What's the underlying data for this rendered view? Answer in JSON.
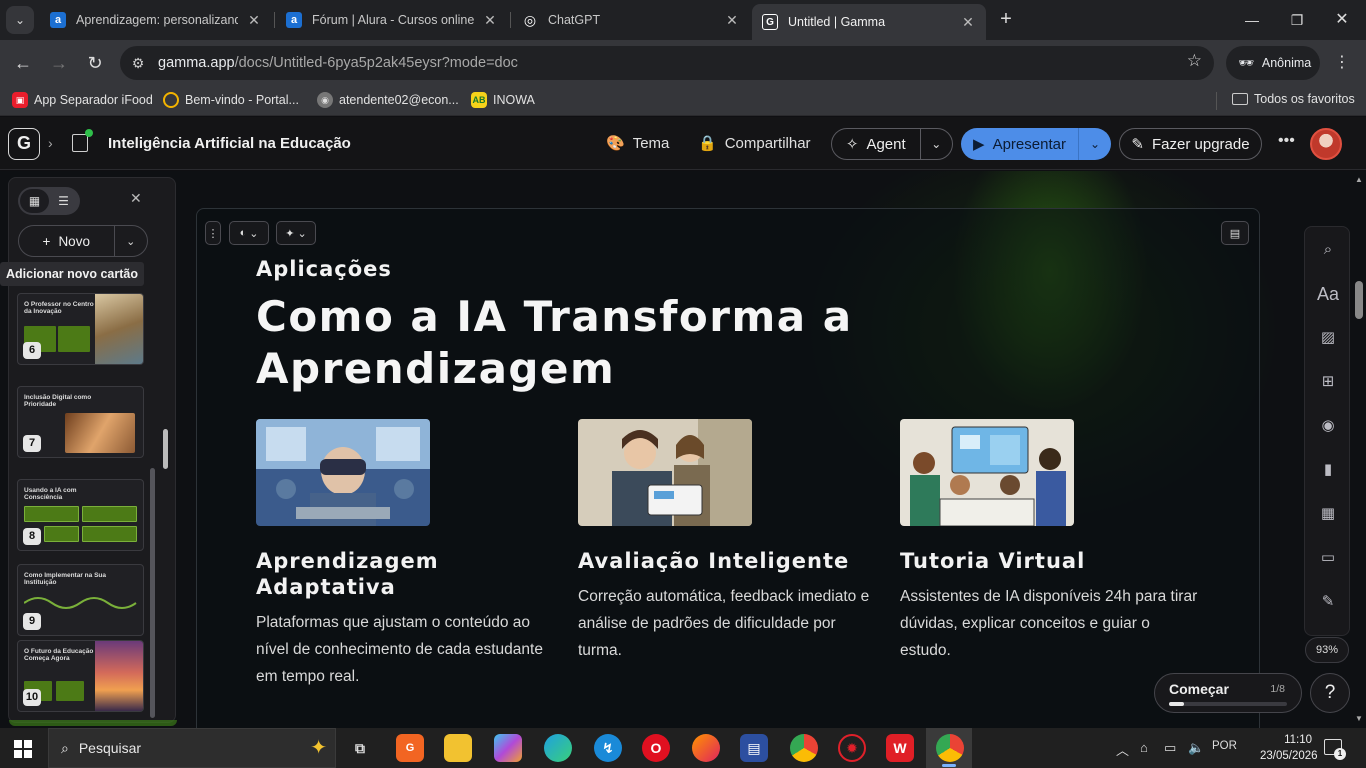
{
  "browser": {
    "tabs": [
      {
        "title": "Aprendizagem: personalizando",
        "favicon": "a",
        "favicon_color": "#1c6fd1",
        "active": false
      },
      {
        "title": "Fórum | Alura - Cursos online d",
        "favicon": "a",
        "favicon_color": "#1c6fd1",
        "active": false
      },
      {
        "title": "ChatGPT",
        "favicon": "◎",
        "favicon_color": "#ffffff",
        "active": false
      },
      {
        "title": "Untitled | Gamma",
        "favicon": "G",
        "favicon_color": "#ffffff",
        "active": true
      }
    ],
    "url_host": "gamma.app",
    "url_path": "/docs/Untitled-6pya5p2ak45eysr?mode=doc",
    "profile_label": "Anônima",
    "bookmarks": [
      {
        "label": "App Separador iFood",
        "icon_color": "#ea1d2c",
        "icon": "▣"
      },
      {
        "label": "Bem-vindo - Portal...",
        "icon_color": "#f2b300",
        "icon": "○"
      },
      {
        "label": "atendente02@econ...",
        "icon_color": "#888888",
        "icon": "◉"
      },
      {
        "label": "INOWA",
        "icon_color": "#f6d21a",
        "icon": "AB"
      }
    ],
    "all_bookmarks_label": "Todos os favoritos"
  },
  "app": {
    "logo": "G",
    "doc_title": "Inteligência Artificial na Educação",
    "theme_label": "Tema",
    "share_label": "Compartilhar",
    "agent_label": "Agent",
    "present_label": "Apresentar",
    "upgrade_label": "Fazer upgrade",
    "accent_color": "#4d8de8"
  },
  "sidebar": {
    "new_label": "Novo",
    "tooltip": "Adicionar novo cartão",
    "thumbnails": [
      {
        "number": "6",
        "title": "O Professor no Centro da Inovação"
      },
      {
        "number": "7",
        "title": "Inclusão Digital como Prioridade"
      },
      {
        "number": "8",
        "title": "Usando a IA com Consciência"
      },
      {
        "number": "9",
        "title": "Como Implementar na Sua Instituição"
      },
      {
        "number": "10",
        "title": "O Futuro da Educação Começa Agora"
      }
    ]
  },
  "card": {
    "kicker": "Aplicações",
    "headline": "Como a IA Transforma a Aprendizagem",
    "features": [
      {
        "title": "Aprendizagem Adaptativa",
        "body": "Plataformas que ajustam o conteúdo ao nível de conhecimento de cada estudante em tempo real."
      },
      {
        "title": "Avaliação Inteligente",
        "body": "Correção automática, feedback imediato e análise de padrões de dificuldade por turma."
      },
      {
        "title": "Tutoria Virtual",
        "body": "Assistentes de IA disponíveis 24h para tirar dúvidas, explicar conceitos e guiar o estudo."
      }
    ]
  },
  "rail": {
    "zoom": "93%",
    "start_label": "Começar",
    "start_progress": "1/8",
    "start_fraction": 0.125,
    "help": "?"
  },
  "taskbar": {
    "search_placeholder": "Pesquisar",
    "lang": "POR",
    "time": "11:10",
    "date": "23/05/2026",
    "notifications": "1"
  }
}
